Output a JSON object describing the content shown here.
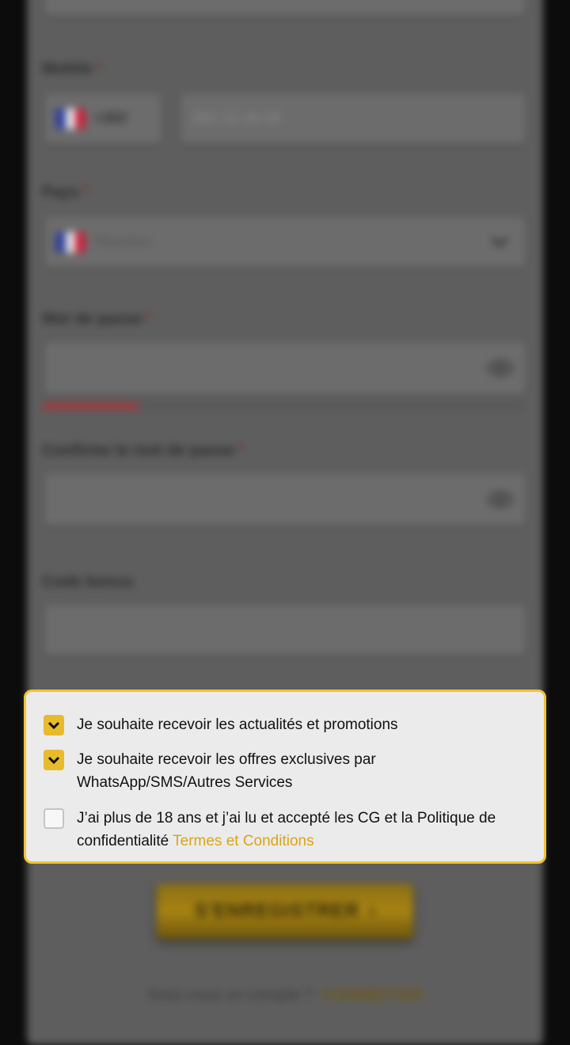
{
  "form": {
    "mobile_label": "Mobile",
    "mobile_dial_code": "+262",
    "mobile_placeholder": "692 12 34 56",
    "country_label": "Pays",
    "country_value": "Reunion",
    "password_label": "Mot de passe",
    "password_strength": 0.2,
    "confirm_label": "Confirme le mot de passe",
    "bonus_label": "Code bonus",
    "required_mark": "*"
  },
  "consents": [
    {
      "text": "Je souhaite recevoir les actualités et promotions",
      "checked": true
    },
    {
      "text": "Je souhaite recevoir les offres exclusives par WhatsApp/SMS/Autres Services",
      "checked": true
    },
    {
      "text": "J’ai plus de 18 ans et j’ai lu et accepté les CG et la Politique de confidentialité ",
      "link": "Termes et Conditions",
      "checked": false
    }
  ],
  "register_button": "S'ENREGISTRER",
  "footer": {
    "question": "Avez-vous un compte ?",
    "login_link": "CONNECTER"
  },
  "colors": {
    "accent": "#f2c330",
    "checkbox_on": "#e7bb2c",
    "link": "#d9a514",
    "strength_bar": "#c0272d"
  },
  "icons": {
    "checkbox_checked": "chevron-down-icon",
    "password_toggle": "eye-icon",
    "country_dropdown": "chevron-down-icon"
  }
}
